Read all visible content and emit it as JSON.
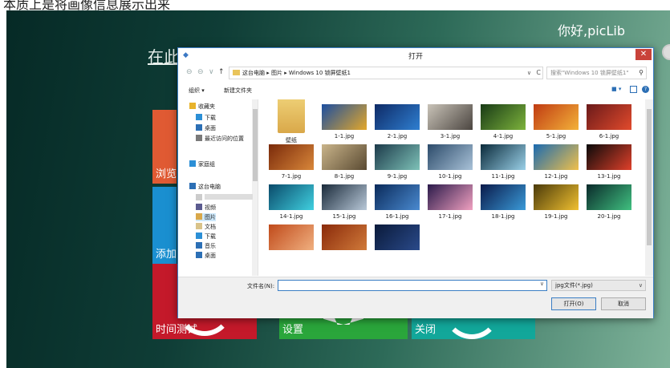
{
  "caption": "本质上是将画像信息展示出来",
  "app": {
    "greeting": "你好,picLib",
    "heading": "在此输入您想要搜索的图片",
    "tiles": {
      "browse": "浏览",
      "add": "添加",
      "timer": "时间测试",
      "settings": "设置",
      "close": "关闭"
    }
  },
  "dialog": {
    "title": "打开",
    "close_glyph": "✕",
    "nav_back": "⊖",
    "nav_forward": "⊖",
    "nav_recent": "∨",
    "nav_up": "↑",
    "address": "这台电脑 ▸ 图片 ▸ Windows 10 锁屏壁纸1",
    "address_dropdown": "∨",
    "refresh_glyph": "C",
    "search_placeholder": "搜索\"Windows 10 锁屏壁纸1\"",
    "search_glyph": "⚲",
    "toolbar": {
      "organize": "组织 ▾",
      "new_folder": "新建文件夹",
      "view_glyph": "■ ▾",
      "help_glyph": "?"
    },
    "nav": [
      {
        "label": "收藏夹",
        "icon": "star-icon",
        "color": "#e8b32b"
      },
      {
        "label": "下载",
        "icon": "download-folder-icon",
        "color": "#2c8fd6"
      },
      {
        "label": "桌面",
        "icon": "desktop-icon",
        "color": "#2c6fb5"
      },
      {
        "label": "最近访问的位置",
        "icon": "recent-places-icon",
        "color": "#7a7a7a"
      },
      {
        "label": "家庭组",
        "icon": "homegroup-icon",
        "color": "#2c8fd6"
      },
      {
        "label": "这台电脑",
        "icon": "computer-icon",
        "color": "#2c6fb5"
      },
      {
        "label": "",
        "icon": "blurred-item-icon",
        "color": "#cccccc"
      },
      {
        "label": "视频",
        "icon": "videos-icon",
        "color": "#5b5b8f"
      },
      {
        "label": "图片",
        "icon": "pictures-icon",
        "color": "#d9a84a"
      },
      {
        "label": "文档",
        "icon": "documents-icon",
        "color": "#d9c38a"
      },
      {
        "label": "下载",
        "icon": "download-folder-icon",
        "color": "#2c8fd6"
      },
      {
        "label": "音乐",
        "icon": "music-icon",
        "color": "#2c6fb5"
      },
      {
        "label": "桌面",
        "icon": "desktop-icon",
        "color": "#2c6fb5"
      }
    ],
    "files": [
      {
        "name": "壁纸",
        "type": "folder"
      },
      {
        "name": "1-1.jpg",
        "colors": [
          "#1b4ea0",
          "#e3a72a"
        ]
      },
      {
        "name": "2-1.jpg",
        "colors": [
          "#0e2a66",
          "#2f7fd1"
        ]
      },
      {
        "name": "3-1.jpg",
        "colors": [
          "#c9c3b8",
          "#4b4540"
        ]
      },
      {
        "name": "4-1.jpg",
        "colors": [
          "#183a16",
          "#7db33c"
        ]
      },
      {
        "name": "5-1.jpg",
        "colors": [
          "#c03b12",
          "#f3b23a"
        ]
      },
      {
        "name": "6-1.jpg",
        "colors": [
          "#6a1a1a",
          "#e24a2c"
        ]
      },
      {
        "name": "7-1.jpg",
        "colors": [
          "#7a2a0a",
          "#d9873a"
        ]
      },
      {
        "name": "8-1.jpg",
        "colors": [
          "#c9b48a",
          "#5a4a32"
        ]
      },
      {
        "name": "9-1.jpg",
        "colors": [
          "#1c3a4a",
          "#7ec2b8"
        ]
      },
      {
        "name": "10-1.jpg",
        "colors": [
          "#2c4b6a",
          "#a9c2d8"
        ]
      },
      {
        "name": "11-1.jpg",
        "colors": [
          "#0a2a3a",
          "#9ad0e8"
        ]
      },
      {
        "name": "12-1.jpg",
        "colors": [
          "#1a6ab0",
          "#f0c04a"
        ]
      },
      {
        "name": "13-1.jpg",
        "colors": [
          "#0a0a0a",
          "#e0402a"
        ]
      },
      {
        "name": "14-1.jpg",
        "colors": [
          "#0a4a6a",
          "#40d0e0"
        ]
      },
      {
        "name": "15-1.jpg",
        "colors": [
          "#1a2a3a",
          "#b8c8d8"
        ]
      },
      {
        "name": "16-1.jpg",
        "colors": [
          "#0a2a5a",
          "#4a8ad0"
        ]
      },
      {
        "name": "17-1.jpg",
        "colors": [
          "#2a1a4a",
          "#f0a0c0"
        ]
      },
      {
        "name": "18-1.jpg",
        "colors": [
          "#0a1a4a",
          "#3a9ad8"
        ]
      },
      {
        "name": "19-1.jpg",
        "colors": [
          "#4a3a0a",
          "#f0c030"
        ]
      },
      {
        "name": "20-1.jpg",
        "colors": [
          "#0a2a2a",
          "#40c080"
        ]
      },
      {
        "name": "",
        "colors": [
          "#c04a1a",
          "#f0b080"
        ]
      },
      {
        "name": "",
        "colors": [
          "#8a2a0a",
          "#d07a3a"
        ]
      },
      {
        "name": "",
        "colors": [
          "#0a1a3a",
          "#2a4a8a"
        ]
      }
    ],
    "footer": {
      "filename_label": "文件名(N):",
      "filename_value": "",
      "filter": "jpg文件(*.jpg)",
      "dropdown_glyph": "∨",
      "open": "打开(O)",
      "cancel": "取消"
    }
  }
}
